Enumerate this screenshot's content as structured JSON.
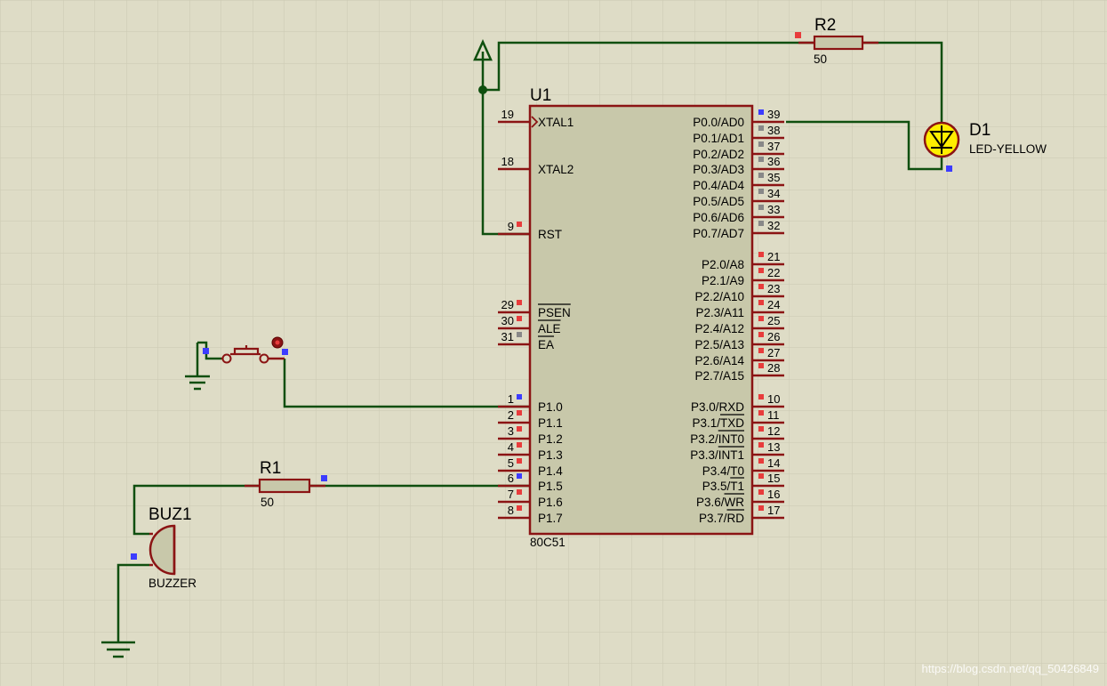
{
  "colors": {
    "background": "#dedcc6",
    "grid": "#cbc9b2",
    "wire": "#0f4f0f",
    "component_outline": "#8b1414",
    "chip_fill": "#c8c8aa",
    "led_fill": "#ffee00",
    "pin_red": "#e83c3c",
    "pin_blue": "#3c3cff",
    "pin_gray": "#888888"
  },
  "u1": {
    "ref": "U1",
    "part": "80C51",
    "left_pins": [
      {
        "num": "19",
        "name": "XTAL1",
        "overline": false,
        "marker": "none"
      },
      {
        "num": "18",
        "name": "XTAL2",
        "overline": false,
        "marker": "none"
      },
      {
        "num": "9",
        "name": "RST",
        "overline": false,
        "marker": "red"
      },
      {
        "num": "29",
        "name": "PSEN",
        "overline": true,
        "marker": "red"
      },
      {
        "num": "30",
        "name": "ALE",
        "overline": true,
        "marker": "red"
      },
      {
        "num": "31",
        "name": "EA",
        "overline": true,
        "marker": "gray"
      },
      {
        "num": "1",
        "name": "P1.0",
        "overline": false,
        "marker": "blue"
      },
      {
        "num": "2",
        "name": "P1.1",
        "overline": false,
        "marker": "red"
      },
      {
        "num": "3",
        "name": "P1.2",
        "overline": false,
        "marker": "red"
      },
      {
        "num": "4",
        "name": "P1.3",
        "overline": false,
        "marker": "red"
      },
      {
        "num": "5",
        "name": "P1.4",
        "overline": false,
        "marker": "red"
      },
      {
        "num": "6",
        "name": "P1.5",
        "overline": false,
        "marker": "blue"
      },
      {
        "num": "7",
        "name": "P1.6",
        "overline": false,
        "marker": "red"
      },
      {
        "num": "8",
        "name": "P1.7",
        "overline": false,
        "marker": "red"
      }
    ],
    "right_pins": [
      {
        "num": "39",
        "prefix": "P0.0/",
        "suffix": "AD0",
        "overline": false,
        "marker": "blue"
      },
      {
        "num": "38",
        "prefix": "P0.1/",
        "suffix": "AD1",
        "overline": false,
        "marker": "gray"
      },
      {
        "num": "37",
        "prefix": "P0.2/",
        "suffix": "AD2",
        "overline": false,
        "marker": "gray"
      },
      {
        "num": "36",
        "prefix": "P0.3/",
        "suffix": "AD3",
        "overline": false,
        "marker": "gray"
      },
      {
        "num": "35",
        "prefix": "P0.4/",
        "suffix": "AD4",
        "overline": false,
        "marker": "gray"
      },
      {
        "num": "34",
        "prefix": "P0.5/",
        "suffix": "AD5",
        "overline": false,
        "marker": "gray"
      },
      {
        "num": "33",
        "prefix": "P0.6/",
        "suffix": "AD6",
        "overline": false,
        "marker": "gray"
      },
      {
        "num": "32",
        "prefix": "P0.7/",
        "suffix": "AD7",
        "overline": false,
        "marker": "gray"
      },
      {
        "num": "21",
        "prefix": "P2.0/",
        "suffix": "A8",
        "overline": false,
        "marker": "red"
      },
      {
        "num": "22",
        "prefix": "P2.1/",
        "suffix": "A9",
        "overline": false,
        "marker": "red"
      },
      {
        "num": "23",
        "prefix": "P2.2/",
        "suffix": "A10",
        "overline": false,
        "marker": "red"
      },
      {
        "num": "24",
        "prefix": "P2.3/",
        "suffix": "A11",
        "overline": false,
        "marker": "red"
      },
      {
        "num": "25",
        "prefix": "P2.4/",
        "suffix": "A12",
        "overline": false,
        "marker": "red"
      },
      {
        "num": "26",
        "prefix": "P2.5/",
        "suffix": "A13",
        "overline": false,
        "marker": "red"
      },
      {
        "num": "27",
        "prefix": "P2.6/",
        "suffix": "A14",
        "overline": false,
        "marker": "red"
      },
      {
        "num": "28",
        "prefix": "P2.7/",
        "suffix": "A15",
        "overline": false,
        "marker": "red"
      },
      {
        "num": "10",
        "prefix": "P3.0/",
        "suffix": "RXD",
        "overline": false,
        "marker": "red"
      },
      {
        "num": "11",
        "prefix": "P3.1/",
        "suffix": "TXD",
        "overline": true,
        "marker": "red"
      },
      {
        "num": "12",
        "prefix": "P3.2/",
        "suffix": "INT0",
        "overline": true,
        "marker": "red"
      },
      {
        "num": "13",
        "prefix": "P3.3/",
        "suffix": "INT1",
        "overline": true,
        "marker": "red"
      },
      {
        "num": "14",
        "prefix": "P3.4/",
        "suffix": "T0",
        "overline": false,
        "marker": "red"
      },
      {
        "num": "15",
        "prefix": "P3.5/",
        "suffix": "T1",
        "overline": true,
        "marker": "red"
      },
      {
        "num": "16",
        "prefix": "P3.6/",
        "suffix": "WR",
        "overline": true,
        "marker": "red"
      },
      {
        "num": "17",
        "prefix": "P3.7/",
        "suffix": "RD",
        "overline": true,
        "marker": "red"
      }
    ]
  },
  "r1": {
    "ref": "R1",
    "value": "50"
  },
  "r2": {
    "ref": "R2",
    "value": "50"
  },
  "d1": {
    "ref": "D1",
    "value": "LED-YELLOW"
  },
  "buz1": {
    "ref": "BUZ1",
    "value": "BUZZER"
  },
  "watermark": "https://blog.csdn.net/qq_50426849"
}
